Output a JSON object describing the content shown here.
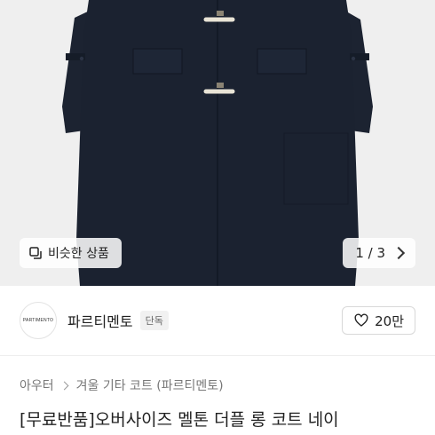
{
  "gallery": {
    "similar_label": "비슷한 상품",
    "pager": "1 / 3"
  },
  "shop": {
    "avatar_text": "PARTIMENTO",
    "name": "파르티멘토",
    "tag": "단독",
    "likes": "20만"
  },
  "breadcrumb": {
    "items": [
      "아우터",
      "겨울 기타 코트 (파르티멘토)"
    ]
  },
  "product": {
    "title": "[무료반품]오버사이즈 멜톤 더플 롱 코트 네이"
  },
  "colors": {
    "coat": "#1b2230",
    "toggle": "#e9e4d6"
  }
}
